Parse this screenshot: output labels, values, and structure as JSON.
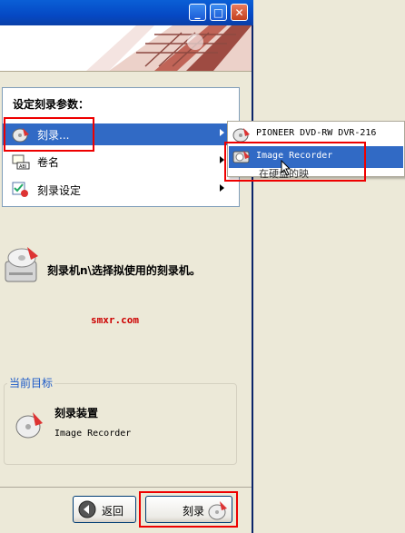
{
  "window": {
    "controls": {
      "minimize": "_",
      "maximize": "□",
      "close": "✕"
    }
  },
  "panel": {
    "title": "设定刻录参数：",
    "menu": [
      {
        "label": "刻录...",
        "icon": "burn-disc-icon",
        "selected": true
      },
      {
        "label": "卷名",
        "icon": "volume-label-icon",
        "selected": false
      },
      {
        "label": "刻录设定",
        "icon": "burn-settings-icon",
        "selected": false
      }
    ]
  },
  "submenu": {
    "items": [
      {
        "label": "PIONEER  DVD-RW  DVR-216",
        "icon": "disc-drive-icon",
        "selected": false
      },
      {
        "label": "Image Recorder",
        "icon": "image-recorder-icon",
        "selected": true
      }
    ],
    "obscured_text": "在硬盘的映"
  },
  "status": {
    "text": "刻录机n\\选择拟使用的刻录机。"
  },
  "watermark": "smxr.com",
  "target": {
    "legend": "当前目标",
    "title": "刻录装置",
    "value": "Image Recorder"
  },
  "buttons": {
    "back": "返回",
    "burn": "刻录"
  },
  "colors": {
    "selection": "#316ac5",
    "highlight_box": "#ee0000",
    "legend_text": "#1c5ac8",
    "watermark": "#cc0000"
  }
}
